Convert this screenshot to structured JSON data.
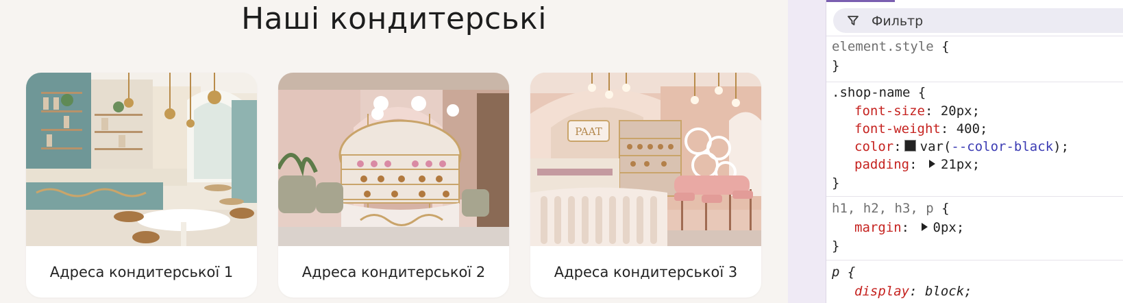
{
  "page": {
    "title": "Наші кондитерські",
    "shops": [
      {
        "name": "Адреса кондитерської 1"
      },
      {
        "name": "Адреса кондитерської 2"
      },
      {
        "name": "Адреса кондитерської 3"
      }
    ]
  },
  "devtools": {
    "filter_placeholder": "Фильтр",
    "rules": {
      "element_style": {
        "selector": "element.style",
        "open": "{",
        "close": "}"
      },
      "shop_name": {
        "selector": ".shop-name",
        "open": "{",
        "close": "}",
        "decls": [
          {
            "prop": "font-size",
            "value": "20px;"
          },
          {
            "prop": "font-weight",
            "value": "400;"
          },
          {
            "prop": "color",
            "value_pre": "var(",
            "var": "--color-black",
            "value_post": ");",
            "swatch_color": "#222222"
          },
          {
            "prop": "padding",
            "value": "21px;"
          }
        ]
      },
      "headings": {
        "selector": "h1, h2, h3, p",
        "open": "{",
        "close": "}",
        "decls": [
          {
            "prop": "margin",
            "value": "0px;"
          }
        ]
      },
      "p": {
        "selector": "p",
        "open": "{",
        "next_prop": "display",
        "next_value": "block;"
      }
    }
  },
  "colors": {
    "page_bg": "#f7f4f1",
    "card_bg": "#ffffff",
    "prop": "#c5221f",
    "var": "#3b3bb3",
    "accent": "#7a5fb0"
  }
}
